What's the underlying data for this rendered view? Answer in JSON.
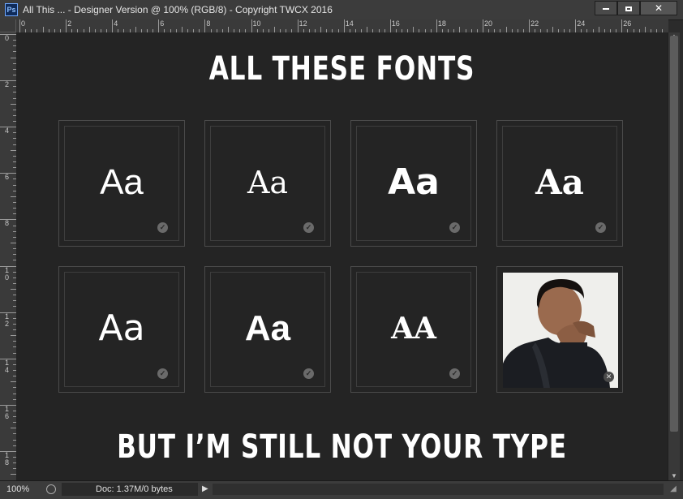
{
  "window": {
    "app_icon": "Ps",
    "title": "All This ... - Designer Version @ 100% (RGB/8) - Copyright TWCX 2016",
    "buttons": [
      "minimize-icon",
      "maximize-icon",
      "close-icon"
    ],
    "close_glyph": "✕"
  },
  "rulers": {
    "top_labels": [
      "0",
      "2",
      "4",
      "6",
      "8",
      "10",
      "12",
      "14",
      "16",
      "18",
      "20",
      "22",
      "24",
      "26",
      "2"
    ],
    "left_labels": [
      "0",
      "2",
      "4",
      "6",
      "8",
      "1\n0",
      "1\n2",
      "1\n4",
      "1\n6",
      "1\n8"
    ]
  },
  "canvas": {
    "heading_top": "ALL THESE FONTS",
    "heading_bottom": "BUT I’M STILL NOT YOUR TYPE",
    "cards": [
      {
        "text": "Aa",
        "style": "sans",
        "badge": "check-icon"
      },
      {
        "text": "Aa",
        "style": "serif",
        "badge": "check-icon"
      },
      {
        "text": "Aa",
        "style": "geometric",
        "badge": "check-icon"
      },
      {
        "text": "Aa",
        "style": "slab-heavy",
        "badge": "check-icon"
      },
      {
        "text": "Aa",
        "style": "rounded",
        "badge": "check-icon"
      },
      {
        "text": "Aa",
        "style": "heavy-sans",
        "badge": "check-icon"
      },
      {
        "text": "AA",
        "style": "wide-serif",
        "badge": "check-icon"
      },
      {
        "photo": "man-covering-mouth-photo",
        "badge": "close-icon"
      }
    ],
    "check_glyph": "✓",
    "x_glyph": "✕"
  },
  "status": {
    "zoom": "100%",
    "doc_info": "Doc: 1.37M/0 bytes",
    "arrow": "▶"
  },
  "colors": {
    "canvas_bg": "#242424",
    "chrome_bg": "#3c3c3c",
    "text": "#ffffff"
  }
}
